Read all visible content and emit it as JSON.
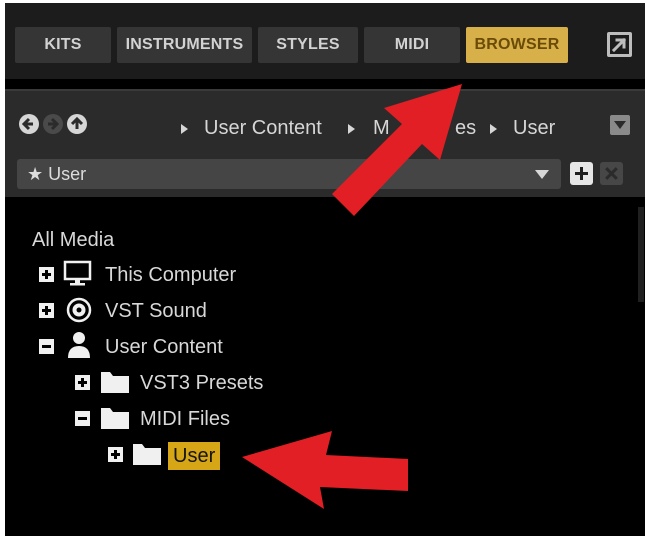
{
  "tabs": [
    {
      "label": "KITS",
      "active": false
    },
    {
      "label": "INSTRUMENTS",
      "active": false
    },
    {
      "label": "STYLES",
      "active": false
    },
    {
      "label": "MIDI",
      "active": false
    },
    {
      "label": "BROWSER",
      "active": true
    }
  ],
  "toolbar": {
    "expand_icon": "expand-arrow-icon"
  },
  "navigation": {
    "back_icon": "back-arrow-icon",
    "forward_icon": "forward-arrow-icon",
    "up_icon": "up-arrow-icon",
    "breadcrumb": [
      "User Content",
      "MIDI Files",
      "User"
    ],
    "breadcrumb_visible": [
      "User Content",
      "M",
      "es",
      "User"
    ],
    "menu_icon": "dropdown-menu-icon"
  },
  "filter": {
    "value": "User",
    "prefix_icon": "star-icon",
    "add_icon": "plus-icon",
    "remove_icon": "close-icon"
  },
  "tree": {
    "root": "All Media",
    "items": [
      {
        "label": "This Computer",
        "icon": "monitor-icon",
        "expanded": false,
        "depth": 0
      },
      {
        "label": "VST Sound",
        "icon": "disc-icon",
        "expanded": false,
        "depth": 0
      },
      {
        "label": "User Content",
        "icon": "user-icon",
        "expanded": true,
        "depth": 0
      },
      {
        "label": "VST3 Presets",
        "icon": "folder-icon",
        "expanded": false,
        "depth": 1
      },
      {
        "label": "MIDI Files",
        "icon": "folder-icon",
        "expanded": true,
        "depth": 1
      },
      {
        "label": "User",
        "icon": "folder-icon",
        "expanded": false,
        "depth": 2,
        "selected": true
      }
    ]
  },
  "colors": {
    "active_tab": "#d8b04a",
    "selection": "#d7a617",
    "annotation_arrow": "#e11f24"
  }
}
